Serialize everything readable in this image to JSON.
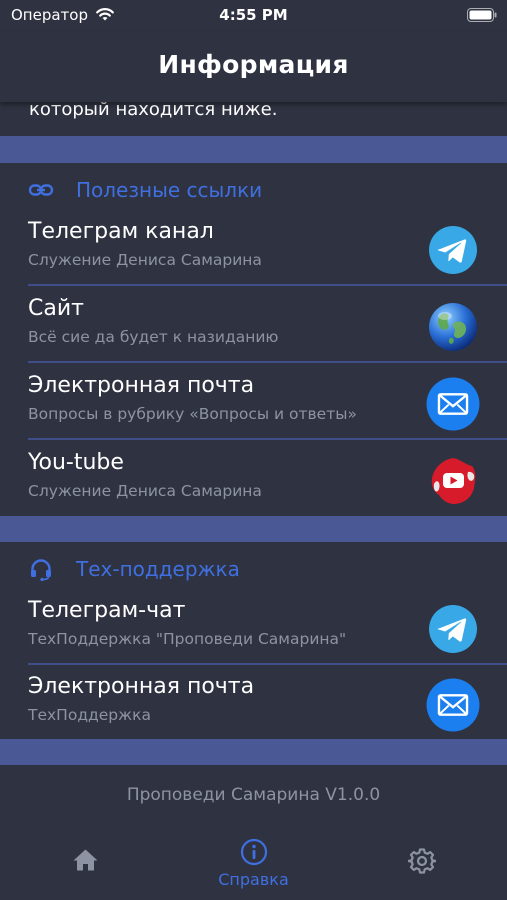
{
  "status_bar": {
    "carrier": "Оператор",
    "time": "4:55 PM"
  },
  "nav": {
    "title": "Информация"
  },
  "intro_text_tail": "который находится ниже.",
  "sections": [
    {
      "header": "Полезные ссылки",
      "header_icon": "link-icon",
      "rows": [
        {
          "title": "Телеграм канал",
          "subtitle": "Служение Дениса Самарина",
          "icon": "telegram-icon"
        },
        {
          "title": "Сайт",
          "subtitle": "Всё сие да будет к назиданию",
          "icon": "globe-icon"
        },
        {
          "title": "Электронная почта",
          "subtitle": "Вопросы в рубрику «Вопросы и ответы»",
          "icon": "mail-icon"
        },
        {
          "title": "You-tube",
          "subtitle": "Служение Дениса Самарина",
          "icon": "youtube-icon"
        }
      ]
    },
    {
      "header": "Тех-поддержка",
      "header_icon": "headset-icon",
      "rows": [
        {
          "title": "Телеграм-чат",
          "subtitle": "ТехПоддержка \"Проповеди Самарина\"",
          "icon": "telegram-icon"
        },
        {
          "title": "Электронная почта",
          "subtitle": "ТехПоддержка",
          "icon": "mail-icon"
        }
      ]
    }
  ],
  "footer": {
    "version": "Проповеди Самарина V1.0.0"
  },
  "tab_bar": {
    "items": [
      {
        "label": "",
        "icon": "home-icon",
        "active": false
      },
      {
        "label": "Справка",
        "icon": "info-icon",
        "active": true
      },
      {
        "label": "",
        "icon": "gear-icon",
        "active": false
      }
    ]
  },
  "colors": {
    "background": "#2f3341",
    "accent": "#3f6fe0",
    "band": "#4a5996",
    "secondary_text": "#8e93a4"
  }
}
